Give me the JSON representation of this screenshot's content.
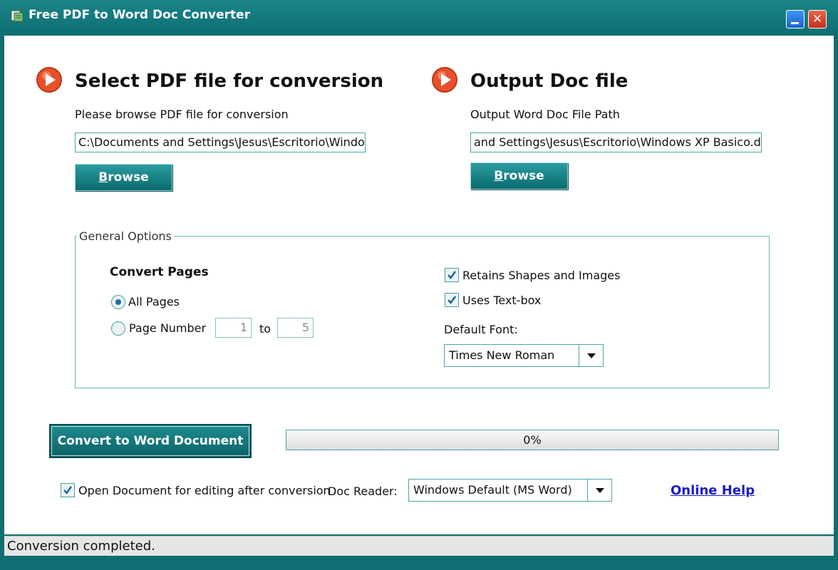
{
  "window": {
    "title": "Free PDF to Word Doc Converter"
  },
  "input_section": {
    "heading": "Select PDF file for conversion",
    "label": "Please browse PDF file for conversion",
    "path": "C:\\Documents and Settings\\Jesus\\Escritorio\\Windows",
    "browse_first": "B",
    "browse_rest": "rowse"
  },
  "output_section": {
    "heading": "Output Doc file",
    "label": "Output Word Doc File Path",
    "path": "and Settings\\Jesus\\Escritorio\\Windows XP Basico.doc",
    "browse_first": "B",
    "browse_rest": "rowse"
  },
  "options": {
    "legend": "General Options",
    "convert_pages_title": "Convert Pages",
    "all_pages_label": "All Pages",
    "page_number_label": "Page Number",
    "page_from": "1",
    "to_label": "to",
    "page_to": "5",
    "retain_shapes_label": "Retains Shapes and Images",
    "uses_textbox_label": "Uses Text-box",
    "default_font_label": "Default Font:",
    "default_font_value": "Times New Roman",
    "all_pages_selected": true,
    "retain_shapes_checked": true,
    "uses_textbox_checked": true
  },
  "actions": {
    "convert_label": "Convert to Word Document",
    "progress": 0,
    "progress_text": "0%"
  },
  "footer": {
    "open_doc_label": "Open Document for editing after conversion",
    "open_doc_checked": true,
    "doc_reader_label": "Doc Reader:",
    "doc_reader_value": "Windows Default (MS Word)",
    "online_help": "Online Help"
  },
  "status": {
    "text": "Conversion completed."
  },
  "colors": {
    "frame": "#0e6e72",
    "accent": "#2a9ca0",
    "arrow": "#e8502a",
    "link": "#1a1acc"
  }
}
